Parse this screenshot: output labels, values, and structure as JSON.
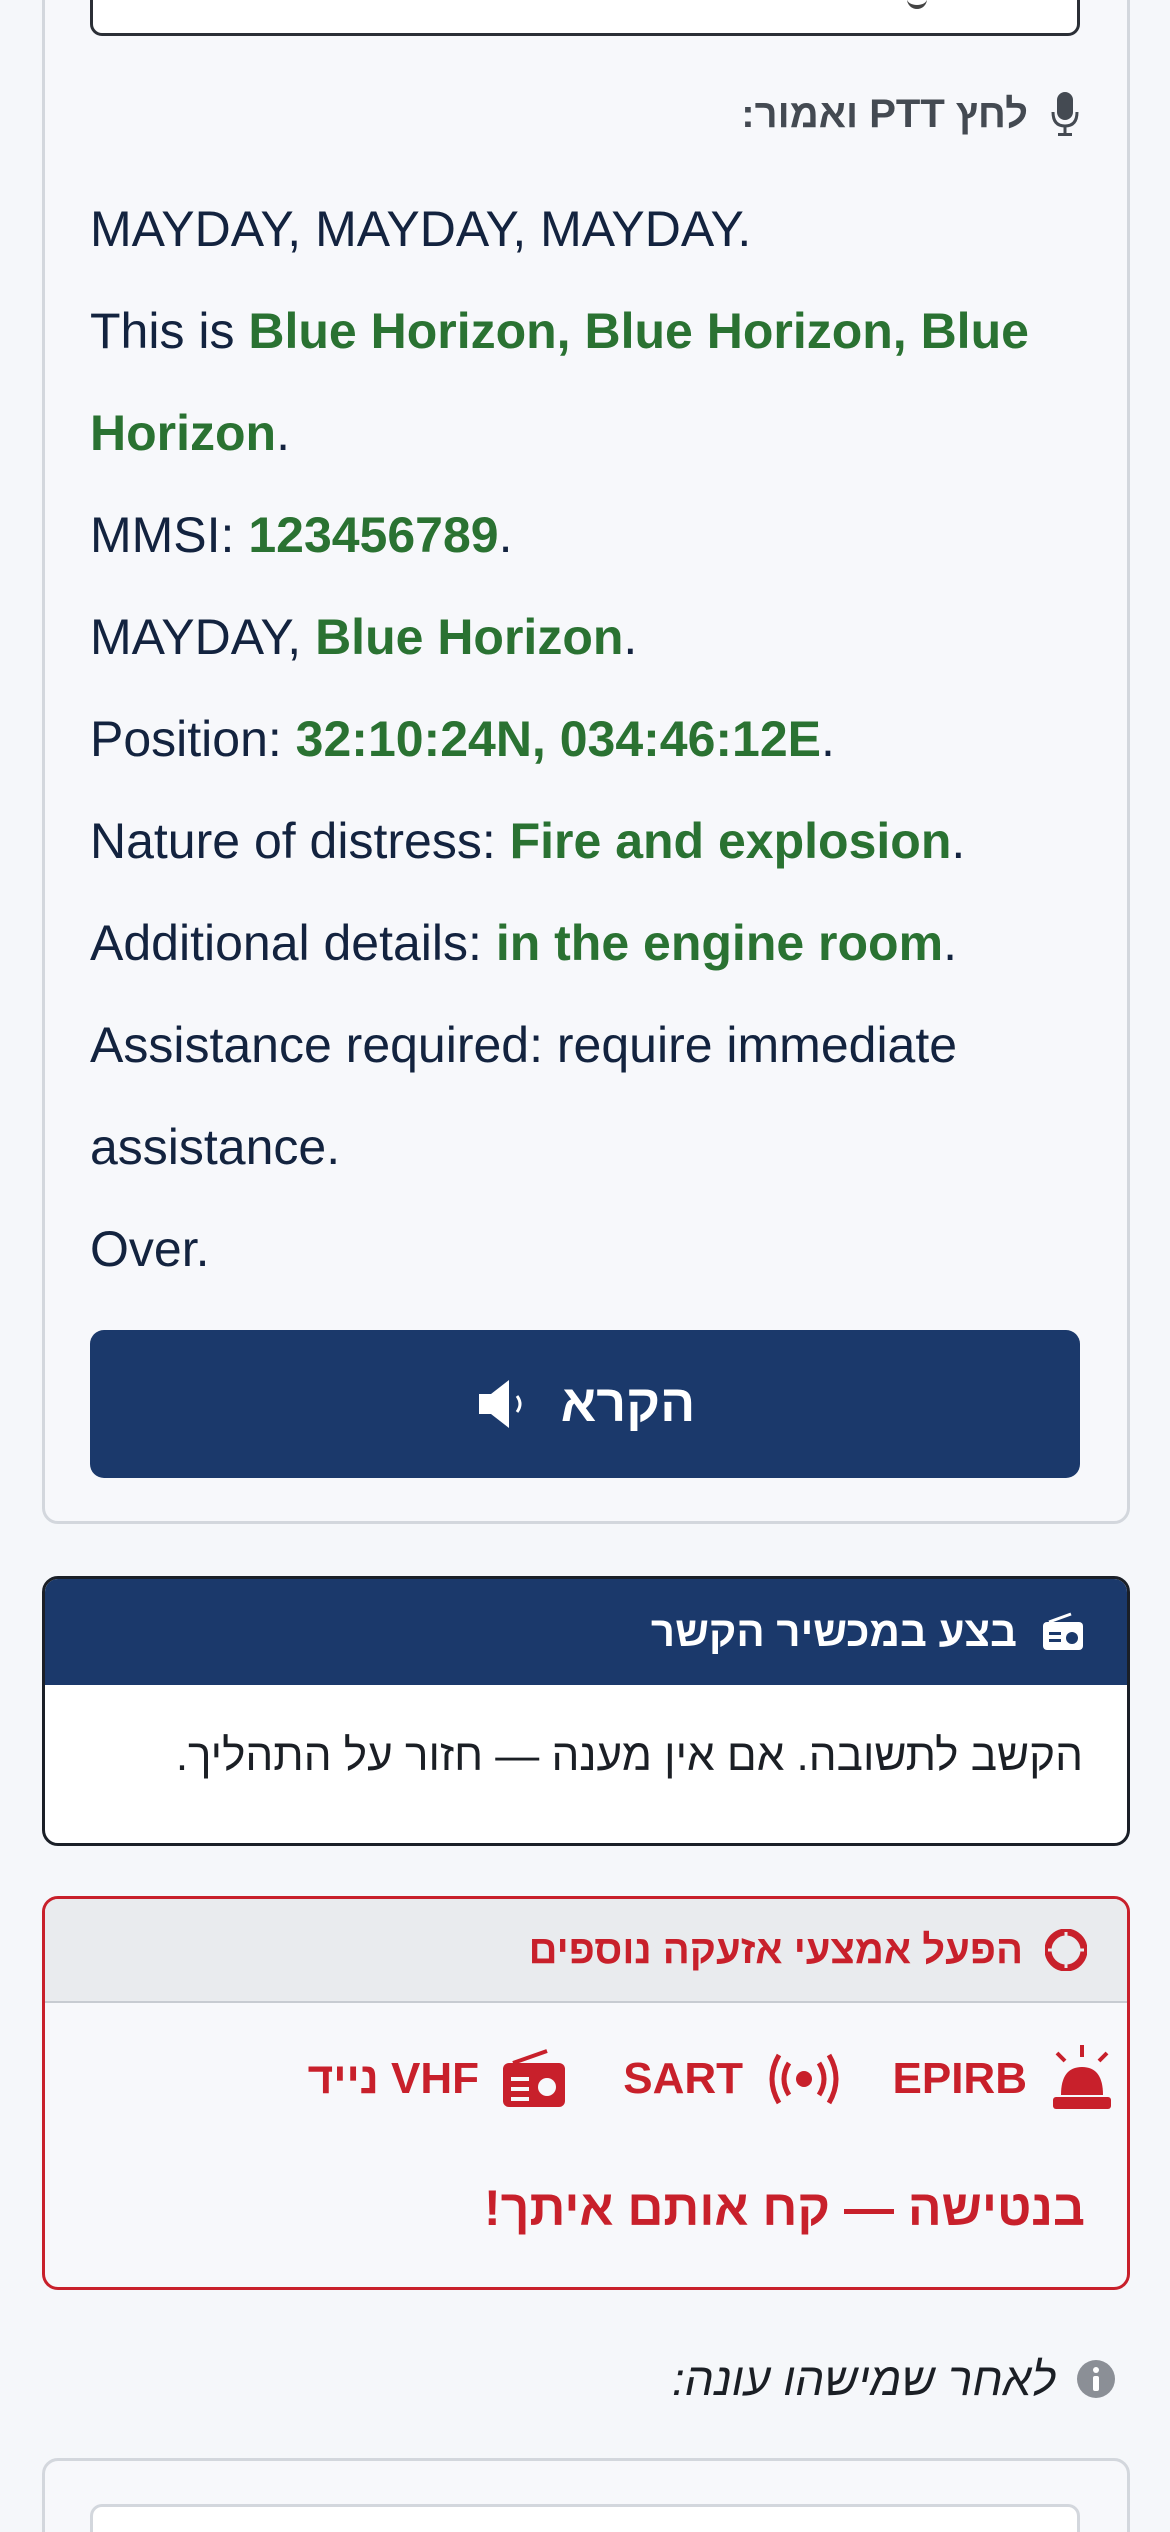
{
  "ptt": {
    "label": "לחץ PTT ואמור:",
    "icon": "microphone-icon"
  },
  "script": {
    "line1": "MAYDAY, MAYDAY, MAYDAY.",
    "this_is_prefix": "This is ",
    "vessel_triple": "Blue Horizon, Blue Horizon, Blue Horizon",
    "period": ".",
    "mmsi_prefix": "MMSI: ",
    "mmsi": "123456789",
    "mayday_prefix": "MAYDAY, ",
    "vessel": "Blue Horizon",
    "position_prefix": "Position: ",
    "position": "32:10:24N, 034:46:12E",
    "nature_prefix": "Nature of distress: ",
    "nature": "Fire and explosion",
    "details_prefix": "Additional details: ",
    "details": "in the engine room",
    "assistance_line": "Assistance required: require immediate assistance.",
    "over": "Over."
  },
  "read_button": {
    "label": "הקרא",
    "icon": "speaker-icon"
  },
  "radio_card": {
    "title": "בצע במכשיר הקשר",
    "icon": "radio-icon",
    "body": "הקשב לתשובה. אם אין מענה — חזור על התהליך."
  },
  "alert_card": {
    "title": "הפעל אמצעי אזעקה נוספים",
    "icon": "lifebuoy-icon",
    "devices": [
      {
        "label": "EPIRB",
        "icon": "beacon-siren-icon"
      },
      {
        "label": "SART",
        "icon": "broadcast-icon"
      },
      {
        "label": "VHF נייד",
        "icon": "handheld-radio-icon"
      }
    ],
    "warning": "בנטישה — קח אותם איתך!"
  },
  "after_answer": {
    "label": "לאחר שמישהו עונה:",
    "icon": "info-icon"
  },
  "colors": {
    "navy": "#1b396b",
    "highlight_green": "#2a7232",
    "alert_red": "#c8202b",
    "text": "#13233f"
  }
}
